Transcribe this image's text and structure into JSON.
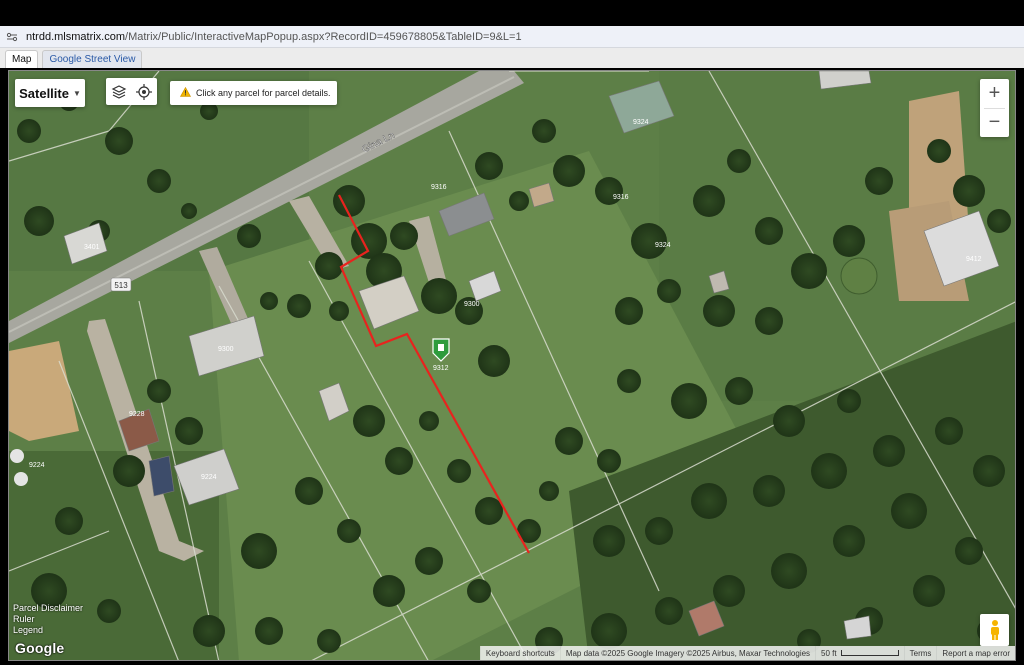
{
  "browser": {
    "url_host": "ntrdd.mlsmatrix.com",
    "url_path": "/Matrix/Public/InteractiveMapPopup.aspx?RecordID=459678805&TableID=9&L=1"
  },
  "tabs": [
    {
      "label": "Map",
      "active": true
    },
    {
      "label": "Google Street View",
      "active": false
    }
  ],
  "map": {
    "type_label": "Satellite",
    "hint_text": "Click any parcel for parcel details.",
    "zoom_in": "+",
    "zoom_out": "−",
    "road_name": "Gina Ln",
    "road_shield": "513",
    "parcel_labels": [
      "3401",
      "9316",
      "9316",
      "9324",
      "9324",
      "9412",
      "9300",
      "9300",
      "9312",
      "9228",
      "9224",
      "9224"
    ],
    "left_links": [
      "Parcel Disclaimer",
      "Ruler",
      "Legend"
    ],
    "logo": "Google",
    "footer": {
      "shortcuts": "Keyboard shortcuts",
      "attribution": "Map data ©2025 Google Imagery ©2025 Airbus, Maxar Technologies",
      "scale": "50 ft",
      "terms": "Terms",
      "report": "Report a map error"
    },
    "colors": {
      "boundary": "#e8231e",
      "marker": "#2e9b3c",
      "grass": "#5b7d45"
    }
  }
}
